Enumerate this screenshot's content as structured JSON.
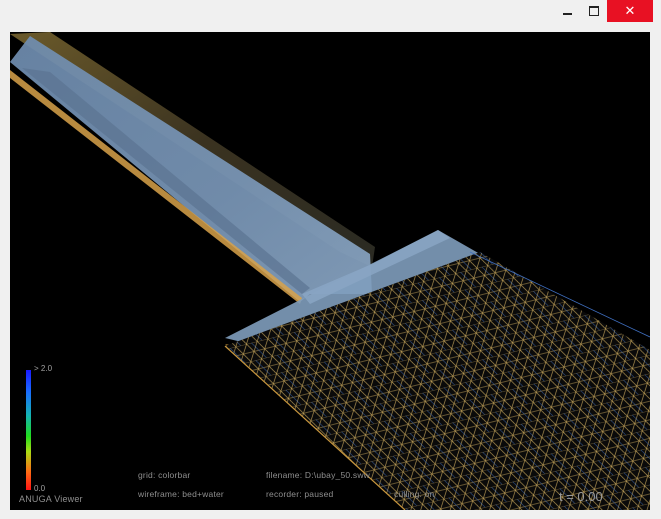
{
  "window": {
    "minimize_glyph": "minimize-icon",
    "maximize_glyph": "maximize-icon",
    "close_glyph": "✕"
  },
  "colorbar": {
    "max_label": "> 2.0",
    "min_label": "0.0",
    "colors": [
      "#1a1aff",
      "#14b3b3",
      "#1fdc1f",
      "#ff6a14",
      "#ff1414"
    ]
  },
  "hud": {
    "app_name": "ANUGA Viewer",
    "grid": "grid: colorbar",
    "wireframe": "wireframe: bed+water",
    "filename": "filename: D:\\ubay_50.sww",
    "recorder": "recorder: paused",
    "culling": "culling: on",
    "time": "t = 0.00"
  },
  "colors": {
    "background": "#000000",
    "bed_edge": "#d8a24a",
    "water": "#6f8fb0",
    "mesh_line": "#c9a85c",
    "mesh_blue": "#3f6fc0"
  }
}
